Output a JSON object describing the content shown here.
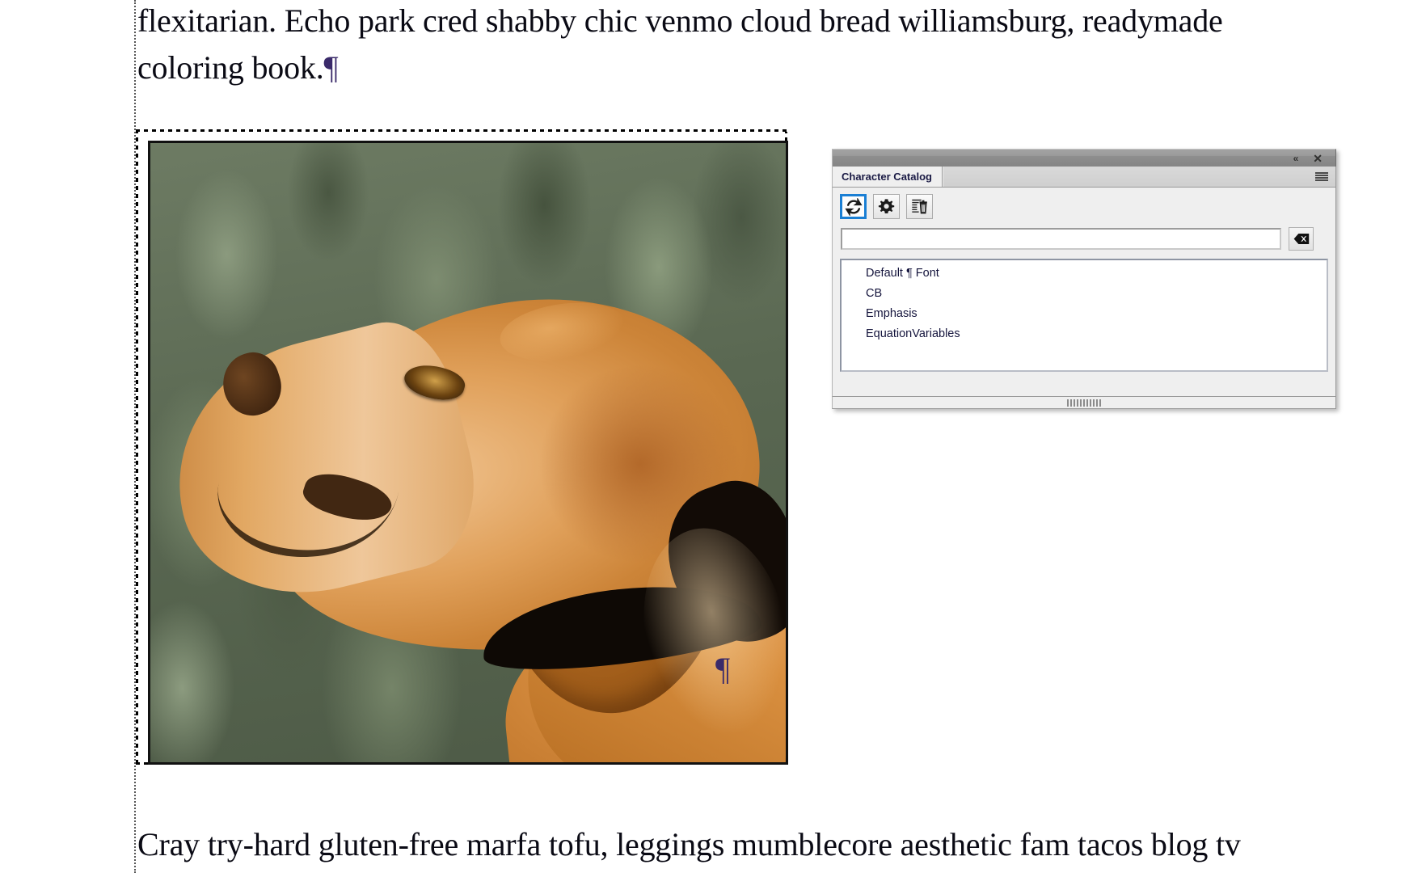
{
  "document": {
    "paragraph_top": {
      "line1": "flexitarian. Echo park cred shabby chic venmo cloud bread williamsburg, readymade",
      "line2": "coloring book.",
      "pilcrow": "¶"
    },
    "paragraph_bottom": {
      "line1": "Cray try-hard gluten-free marfa tofu, leggings mumblecore aesthetic fam tacos blog tv"
    },
    "anchored_image": {
      "alt": "Photograph of a yellow Labrador retriever dog in profile looking up, blurred green grass background",
      "selected": true,
      "trailing_pilcrow": "¶"
    }
  },
  "panel": {
    "titlebar": {
      "collapse_icon": "«",
      "close_icon": "✕"
    },
    "tabs": [
      {
        "label": "Character Catalog",
        "active": true
      }
    ],
    "menu_icon": "hamburger-menu-icon",
    "toolbar": [
      {
        "name": "refresh-button",
        "icon": "refresh-icon",
        "active": true
      },
      {
        "name": "options-button",
        "icon": "gear-icon",
        "active": false
      },
      {
        "name": "delete-button",
        "icon": "list-trash-icon",
        "active": false
      }
    ],
    "search": {
      "value": "",
      "placeholder": ""
    },
    "clear_button": {
      "name": "clear-search-button",
      "icon": "backspace-delete-icon"
    },
    "catalog_items": [
      "Default ¶ Font",
      "CB",
      "Emphasis",
      "EquationVariables"
    ],
    "resize_grip": "panel-resize-grip"
  },
  "colors": {
    "accent_blue": "#1a7fd4",
    "panel_bg": "#efefef",
    "titlebar_gray": "#8e8e8e",
    "text_navy": "#14143c",
    "doc_text": "#0a0a14",
    "pilcrow_purple": "#3a2a6a"
  }
}
